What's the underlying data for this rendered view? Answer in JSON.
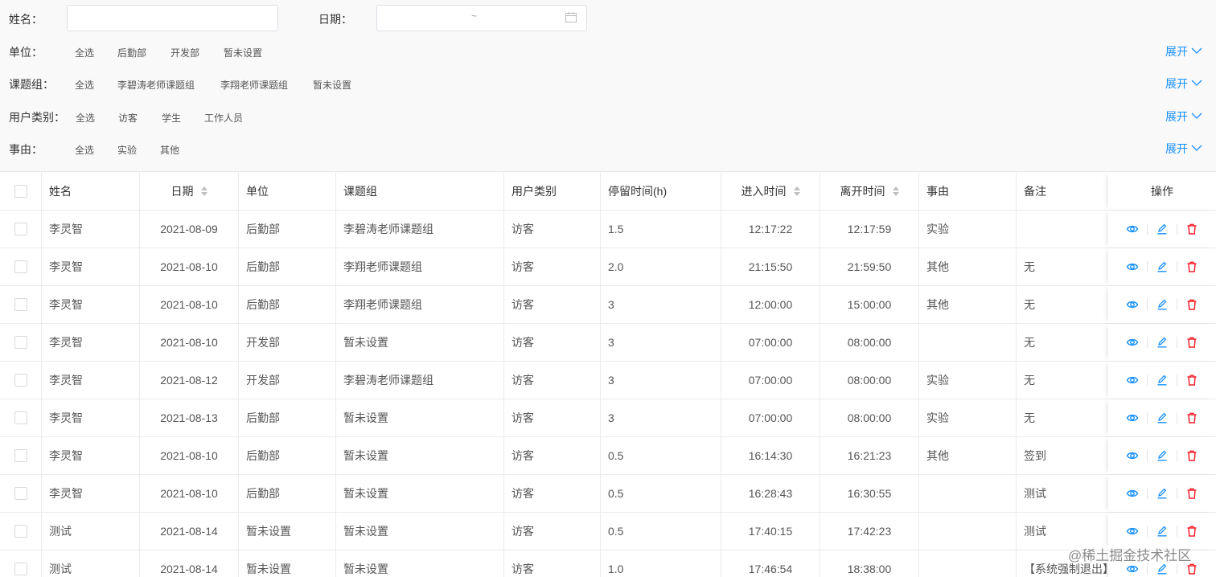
{
  "filters": {
    "name_label": "姓名：",
    "name_value": "",
    "date_label": "日期：",
    "date_range_sep": "~",
    "expand_label": "展开",
    "groups": [
      {
        "label": "单位：",
        "options": [
          "全选",
          "后勤部",
          "开发部",
          "暂未设置"
        ]
      },
      {
        "label": "课题组：",
        "options": [
          "全选",
          "李碧涛老师课题组",
          "李翔老师课题组",
          "暂未设置"
        ]
      },
      {
        "label": "用户类别：",
        "options": [
          "全选",
          "访客",
          "学生",
          "工作人员"
        ]
      },
      {
        "label": "事由：",
        "options": [
          "全选",
          "实验",
          "其他"
        ]
      }
    ]
  },
  "table": {
    "headers": {
      "name": "姓名",
      "date": "日期",
      "unit": "单位",
      "group": "课题组",
      "user_type": "用户类别",
      "stay": "停留时间(h)",
      "enter": "进入时间",
      "leave": "离开时间",
      "reason": "事由",
      "note": "备注",
      "ops": "操作"
    },
    "rows": [
      {
        "name": "李灵智",
        "date": "2021-08-09",
        "unit": "后勤部",
        "group": "李碧涛老师课题组",
        "user_type": "访客",
        "stay": "1.5",
        "enter": "12:17:22",
        "leave": "12:17:59",
        "reason": "实验",
        "note": ""
      },
      {
        "name": "李灵智",
        "date": "2021-08-10",
        "unit": "后勤部",
        "group": "李翔老师课题组",
        "user_type": "访客",
        "stay": "2.0",
        "enter": "21:15:50",
        "leave": "21:59:50",
        "reason": "其他",
        "note": "无"
      },
      {
        "name": "李灵智",
        "date": "2021-08-10",
        "unit": "后勤部",
        "group": "李翔老师课题组",
        "user_type": "访客",
        "stay": "3",
        "enter": "12:00:00",
        "leave": "15:00:00",
        "reason": "其他",
        "note": "无"
      },
      {
        "name": "李灵智",
        "date": "2021-08-10",
        "unit": "开发部",
        "group": "暂未设置",
        "user_type": "访客",
        "stay": "3",
        "enter": "07:00:00",
        "leave": "08:00:00",
        "reason": "",
        "note": "无"
      },
      {
        "name": "李灵智",
        "date": "2021-08-12",
        "unit": "开发部",
        "group": "李碧涛老师课题组",
        "user_type": "访客",
        "stay": "3",
        "enter": "07:00:00",
        "leave": "08:00:00",
        "reason": "实验",
        "note": "无"
      },
      {
        "name": "李灵智",
        "date": "2021-08-13",
        "unit": "后勤部",
        "group": "暂未设置",
        "user_type": "访客",
        "stay": "3",
        "enter": "07:00:00",
        "leave": "08:00:00",
        "reason": "实验",
        "note": "无"
      },
      {
        "name": "李灵智",
        "date": "2021-08-10",
        "unit": "后勤部",
        "group": "暂未设置",
        "user_type": "访客",
        "stay": "0.5",
        "enter": "16:14:30",
        "leave": "16:21:23",
        "reason": "其他",
        "note": "签到"
      },
      {
        "name": "李灵智",
        "date": "2021-08-10",
        "unit": "后勤部",
        "group": "暂未设置",
        "user_type": "访客",
        "stay": "0.5",
        "enter": "16:28:43",
        "leave": "16:30:55",
        "reason": "",
        "note": "测试"
      },
      {
        "name": "测试",
        "date": "2021-08-14",
        "unit": "暂未设置",
        "group": "暂未设置",
        "user_type": "访客",
        "stay": "0.5",
        "enter": "17:40:15",
        "leave": "17:42:23",
        "reason": "",
        "note": "测试"
      },
      {
        "name": "测试",
        "date": "2021-08-14",
        "unit": "暂未设置",
        "group": "暂未设置",
        "user_type": "访客",
        "stay": "1.0",
        "enter": "17:46:54",
        "leave": "18:38:00",
        "reason": "",
        "note": "【系统强制退出】"
      }
    ],
    "row_actions": [
      "eye-icon",
      "edit-icon",
      "delete-icon"
    ]
  },
  "colors": {
    "link": "#1890ff",
    "danger": "#f5222d",
    "filter_bg": "#f9f9f9"
  },
  "watermark": "@稀土掘金技术社区"
}
